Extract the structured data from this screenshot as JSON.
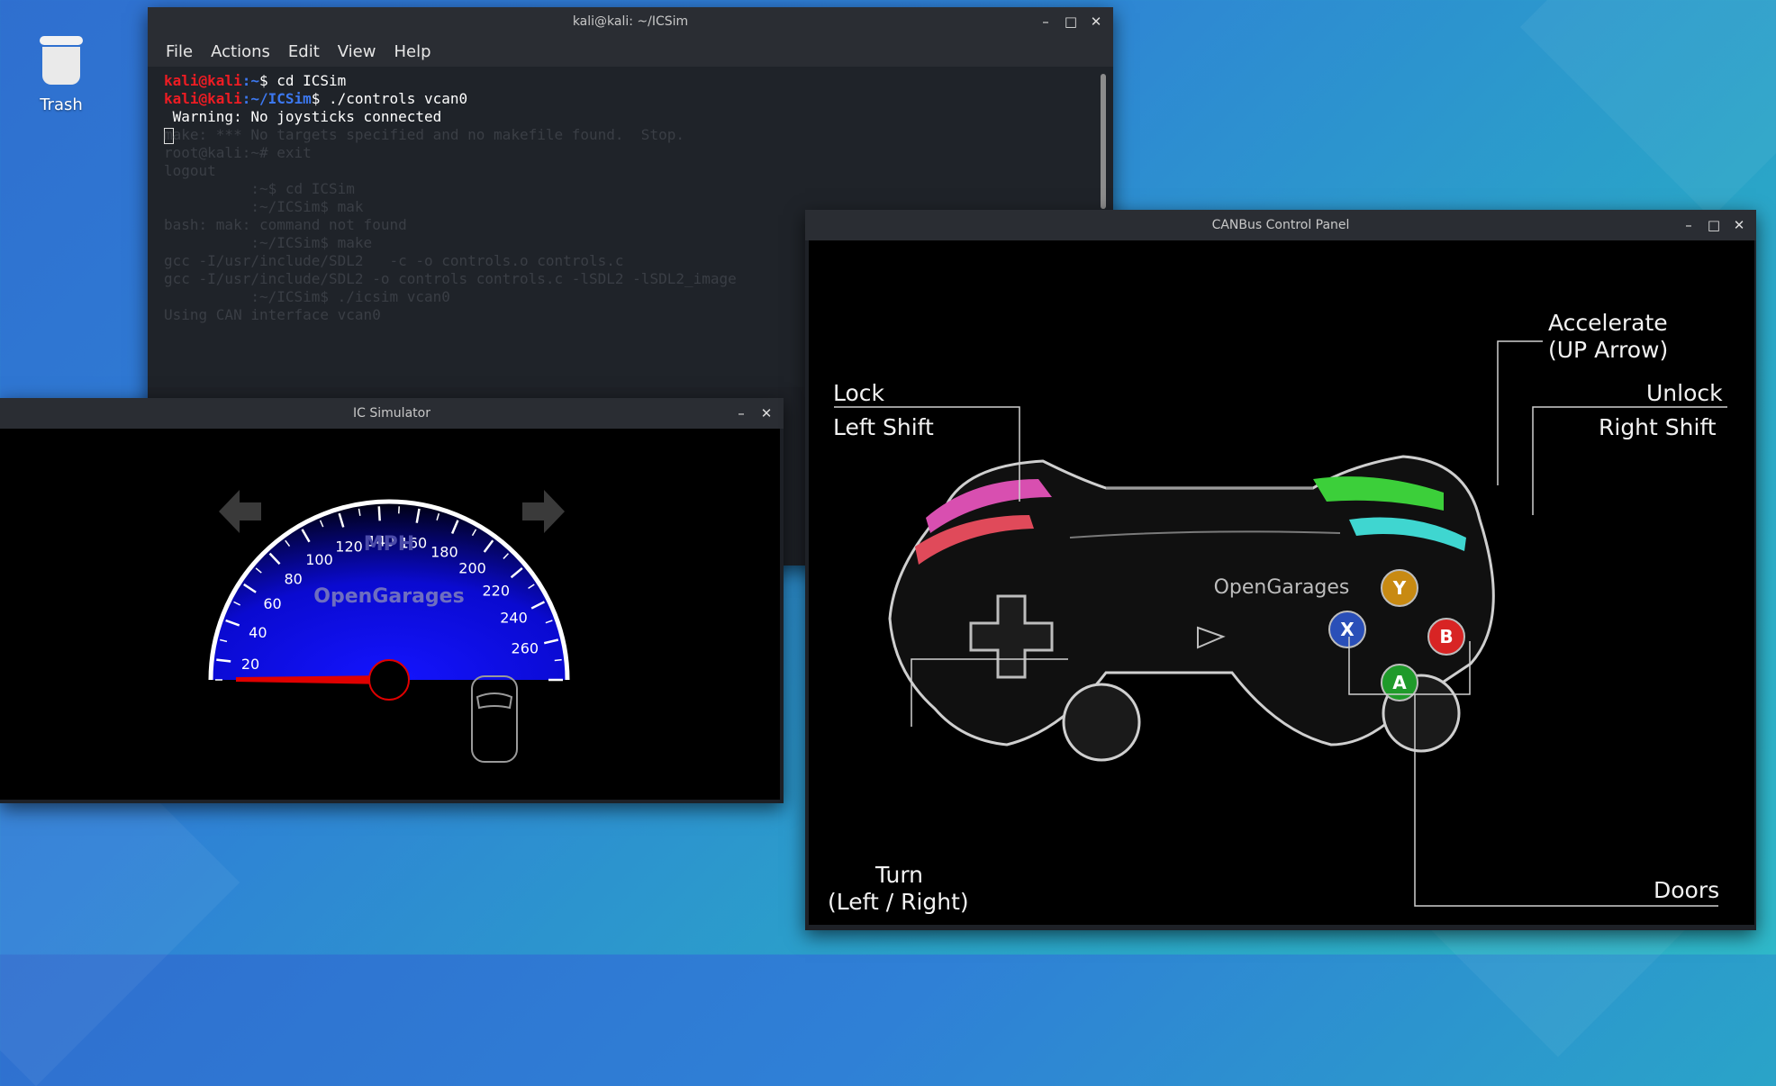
{
  "desktop": {
    "trash_label": "Trash"
  },
  "terminal": {
    "title": "kali@kali: ~/ICSim",
    "menu": [
      "File",
      "Actions",
      "Edit",
      "View",
      "Help"
    ],
    "lines": [
      {
        "user": "kali@kali",
        "path": ":~",
        "cmd": "$ cd ICSim"
      },
      {
        "user": "kali@kali",
        "path": ":~/ICSim",
        "cmd": "$ ./controls vcan0"
      }
    ],
    "output": " Warning: No joysticks connected",
    "ghost_lines": [
      "make: *** No targets specified and no makefile found.  Stop.",
      "root@kali:~# exit",
      "logout",
      "          :~$ cd ICSim",
      "          :~/ICSim$ mak",
      "bash: mak: command not found",
      "          :~/ICSim$ make",
      "gcc -I/usr/include/SDL2   -c -o controls.o controls.c",
      "gcc -I/usr/include/SDL2 -o controls controls.c -lSDL2 -lSDL2_image",
      "          :~/ICSim$ ./icsim vcan0",
      "Using CAN interface vcan0"
    ]
  },
  "ic_sim": {
    "title": "IC Simulator",
    "unit": "MPH",
    "brand": "OpenGarages",
    "ticks": [
      "20",
      "40",
      "60",
      "80",
      "100",
      "120",
      "140",
      "160",
      "180",
      "200",
      "220",
      "240",
      "260"
    ],
    "speed": 0
  },
  "control_panel": {
    "title": "CANBus Control Panel",
    "brand": "OpenGarages",
    "labels": {
      "accelerate": "Accelerate",
      "accelerate_key": "(UP Arrow)",
      "lock": "Lock",
      "lock_key": "Left Shift",
      "unlock": "Unlock",
      "unlock_key": "Right Shift",
      "turn": "Turn",
      "turn_key": "(Left / Right)",
      "doors": "Doors"
    },
    "buttons": {
      "y": "Y",
      "x": "X",
      "b": "B",
      "a": "A"
    },
    "colors": {
      "y": "#c88a12",
      "x": "#2a4fb8",
      "b": "#d82424",
      "a": "#1f9a2a",
      "lock_top": "#d84fb0",
      "lock_bottom": "#e04a5a",
      "unlock_top": "#3ccf3a",
      "unlock_bottom": "#3fd6d0"
    }
  },
  "window_controls": {
    "minimize": "–",
    "maximize": "□",
    "close": "✕"
  }
}
